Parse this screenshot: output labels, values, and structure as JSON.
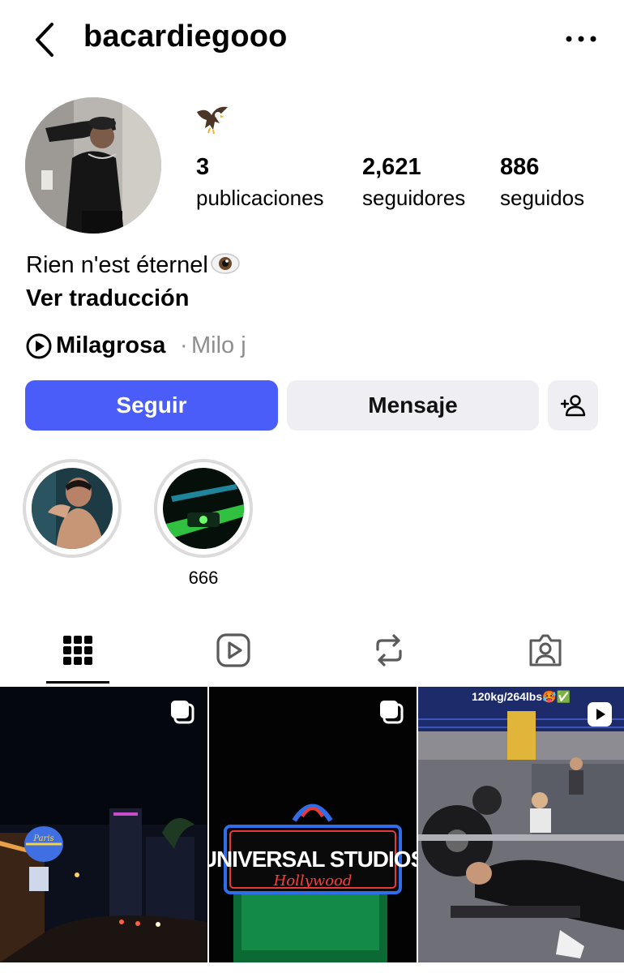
{
  "header": {
    "username": "bacardiegooo",
    "back_icon": "chevron-left-icon",
    "more_icon": "more-horizontal-icon"
  },
  "profile": {
    "emoji_icon": "eagle-emoji",
    "stats": [
      {
        "value": "3",
        "label": "publicaciones"
      },
      {
        "value": "2,621",
        "label": "seguidores"
      },
      {
        "value": "886",
        "label": "seguidos"
      }
    ],
    "bio": "Rien n'est éternel",
    "bio_emoji_icon": "eye-emoji",
    "translate_label": "Ver traducción",
    "music": {
      "icon": "play-circle-icon",
      "song": "Milagrosa",
      "separator": "·",
      "artist": "Milo j"
    }
  },
  "actions": {
    "follow_label": "Seguir",
    "message_label": "Mensaje",
    "add_user_icon": "add-user-icon"
  },
  "highlights": [
    {
      "label": ""
    },
    {
      "label": "666"
    }
  ],
  "tabs": [
    {
      "icon": "grid-icon",
      "active": true
    },
    {
      "icon": "reels-icon",
      "active": false
    },
    {
      "icon": "reposts-icon",
      "active": false
    },
    {
      "icon": "tagged-icon",
      "active": false
    }
  ],
  "posts": [
    {
      "badge_icon": "carousel-icon"
    },
    {
      "badge_icon": "carousel-icon",
      "sign_text": "UNIVERSAL STUDIOS",
      "sign_subtext": "Hollywood"
    },
    {
      "badge_icon": "reel-play-icon",
      "caption": "120kg/264lbs🥵✅"
    }
  ],
  "colors": {
    "follow_button": "#4a5df9",
    "secondary_button": "#efeff3",
    "muted_text": "#8e8e8e"
  }
}
